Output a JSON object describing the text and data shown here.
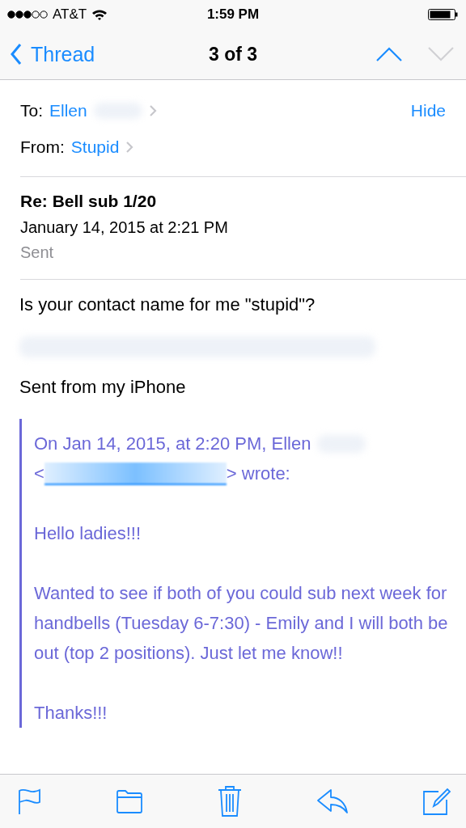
{
  "status_bar": {
    "carrier": "AT&T",
    "time": "1:59 PM"
  },
  "nav": {
    "back": "Thread",
    "title": "3 of 3",
    "previous": {
      "disabled": false
    },
    "next": {
      "disabled": true
    }
  },
  "header": {
    "to_label": "To:",
    "to": "Ellen",
    "to_blurred": true,
    "hide": "Hide",
    "from_label": "From:",
    "from": "Stupid"
  },
  "subject": "Re: Bell sub 1/20",
  "date": "January 14, 2015 at 2:21 PM",
  "mailbox": "Sent",
  "body": [
    "Is your contact name for me \"stupid\"?"
  ],
  "body_blurred_line": true,
  "signature": "Sent from my iPhone",
  "quote": {
    "attribution": "On Jan 14, 2015, at 2:20 PM, Ellen",
    "name_blurred": true,
    "email_open": "<",
    "email_close": "> wrote:",
    "paragraphs": [
      "Hello ladies!!!",
      "Wanted to see if both of you could sub next week for handbells (Tuesday 6-7:30) - Emily and I will both be out (top 2 positions). Just let me know!!",
      "Thanks!!!"
    ]
  },
  "toolbar": [
    {
      "kind": "flag"
    },
    {
      "kind": "folder"
    },
    {
      "kind": "trash"
    },
    {
      "kind": "reply"
    },
    {
      "kind": "compose"
    }
  ]
}
